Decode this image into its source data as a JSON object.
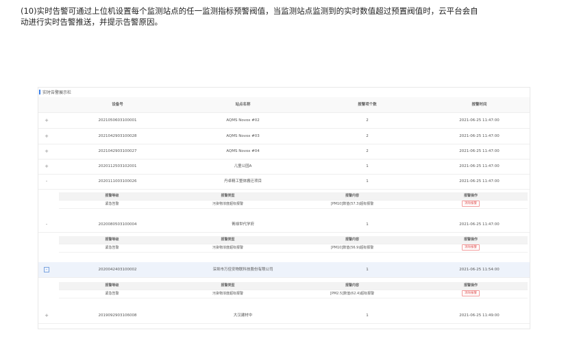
{
  "intro": {
    "line1": "(10)实时告警可通过上位机设置每个监测站点的任一监测指标预警阀值，当监测站点监测到的实时数值超过预置阀值时，云平台会自",
    "line2": "动进行实时告警推送，并提示告警原因。"
  },
  "panel": {
    "title": "实时告警展示栏",
    "columns": [
      "设备号",
      "站点名称",
      "报警项个数",
      "报警时间"
    ],
    "sub_columns": [
      "报警等级",
      "报警类型",
      "报警内容",
      "报警操作"
    ],
    "rows": [
      {
        "toggle": "+",
        "id": "2021050603100001",
        "name": "AQMS Novox #02",
        "count": "2",
        "time": "2021-06-25 11:47:00"
      },
      {
        "toggle": "+",
        "id": "2021042903100028",
        "name": "AQMS Novox #03",
        "count": "2",
        "time": "2021-06-25 11:47:00"
      },
      {
        "toggle": "+",
        "id": "2021042903100027",
        "name": "AQMS Novox #04",
        "count": "2",
        "time": "2021-06-25 11:47:00"
      },
      {
        "toggle": "+",
        "id": "2020112503102001",
        "name": "儿童公园A",
        "count": "1",
        "time": "2021-06-25 11:47:00"
      },
      {
        "toggle": "-",
        "id": "2020111003100026",
        "name": "丹卓精工整体搬迁项目",
        "count": "1",
        "time": "2021-06-25 11:47:00",
        "detail": {
          "level": "紧急告警",
          "type": "污染物浓度超标报警",
          "content": "[PM10]数值(57.3)超标报警",
          "action": "消除报警"
        }
      },
      {
        "toggle": "-",
        "id": "2020080503100004",
        "name": "菁禄世代学府",
        "count": "1",
        "time": "2021-06-25 11:47:00",
        "detail": {
          "level": "紧急告警",
          "type": "污染物浓度超标报警",
          "content": "[PM10]数值(56.9)超标报警",
          "action": "消除报警"
        }
      },
      {
        "toggle": "-",
        "id": "2020042403100002",
        "name": "深圳市万佳安物联科技股份有限公司",
        "count": "1",
        "time": "2021-06-25 11:54:00",
        "detail": {
          "level": "紧急告警",
          "type": "污染物浓度超标报警",
          "content": "[PM2.5]数值(62.4)超标报警",
          "action": "消除报警"
        }
      },
      {
        "toggle": "+",
        "id": "2019092903106008",
        "name": "大汉建材中",
        "count": "1",
        "time": "2021-06-25 11:49:00"
      }
    ]
  },
  "colors": {
    "accent": "#3a7ee8",
    "alarm": "#e05555"
  }
}
